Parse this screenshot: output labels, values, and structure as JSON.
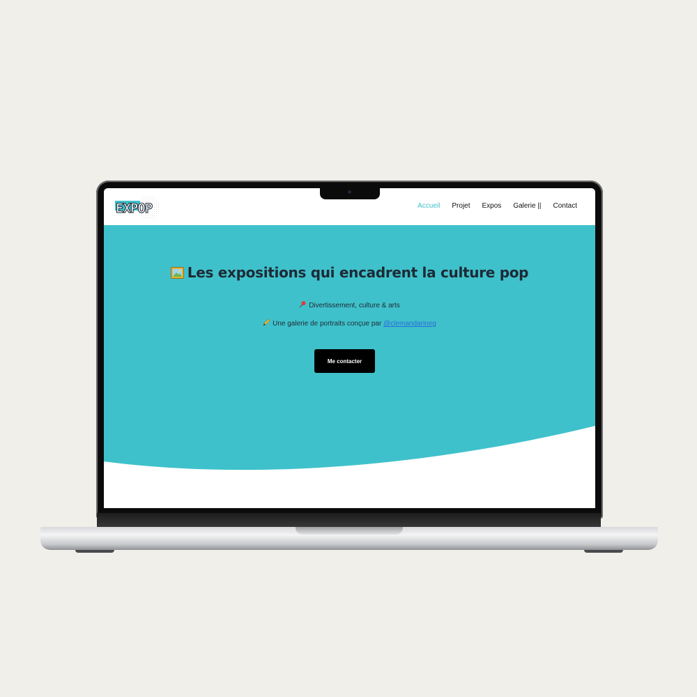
{
  "logo": {
    "text": "EXPOP"
  },
  "nav": {
    "items": [
      {
        "label": "Accueil",
        "active": true
      },
      {
        "label": "Projet",
        "active": false
      },
      {
        "label": "Expos",
        "active": false
      },
      {
        "label": "Galerie ||",
        "active": false
      },
      {
        "label": "Contact",
        "active": false
      }
    ]
  },
  "hero": {
    "title": "Les expositions qui encadrent la culture pop",
    "title_icon": "framed-picture-icon",
    "line1_icon": "pushpin-icon",
    "line1_text": "Divertissement, culture & arts",
    "line2_icon": "pencil-icon",
    "line2_prefix": "Une galerie de portraits conçue par ",
    "line2_link": "@clemandarineg",
    "cta_label": "Me contacter"
  },
  "colors": {
    "accent": "#3fc1cb",
    "text_dark": "#1d2a35",
    "button_bg": "#000000",
    "link": "#2a6bd6",
    "page_bg": "#f0efea"
  }
}
